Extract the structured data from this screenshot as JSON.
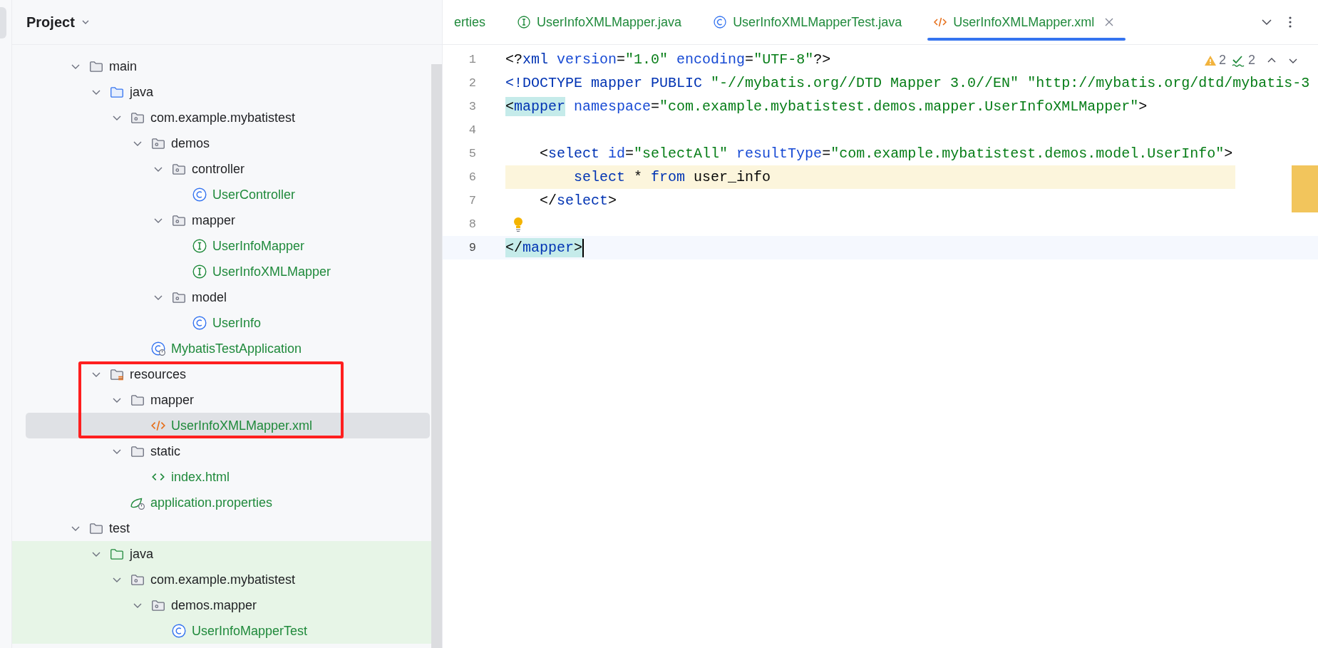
{
  "project_panel": {
    "title": "Project",
    "tree": [
      {
        "label": "main",
        "kind": "folder",
        "expanded": true,
        "selected": false,
        "vcs_added": false,
        "boxed": false,
        "children": [
          {
            "label": "java",
            "kind": "source-folder",
            "expanded": true,
            "selected": false,
            "vcs_added": false,
            "boxed": false,
            "children": [
              {
                "label": "com.example.mybatistest",
                "kind": "package",
                "expanded": true,
                "selected": false,
                "vcs_added": false,
                "boxed": false,
                "children": [
                  {
                    "label": "demos",
                    "kind": "package",
                    "expanded": true,
                    "selected": false,
                    "vcs_added": false,
                    "boxed": false,
                    "children": [
                      {
                        "label": "controller",
                        "kind": "package",
                        "expanded": true,
                        "selected": false,
                        "vcs_added": false,
                        "boxed": false,
                        "children": [
                          {
                            "label": "UserController",
                            "kind": "class",
                            "selected": false,
                            "vcs_added": true,
                            "boxed": false
                          }
                        ]
                      },
                      {
                        "label": "mapper",
                        "kind": "package",
                        "expanded": true,
                        "selected": false,
                        "vcs_added": false,
                        "boxed": false,
                        "children": [
                          {
                            "label": "UserInfoMapper",
                            "kind": "interface",
                            "selected": false,
                            "vcs_added": true,
                            "boxed": false
                          },
                          {
                            "label": "UserInfoXMLMapper",
                            "kind": "interface",
                            "selected": false,
                            "vcs_added": true,
                            "boxed": false
                          }
                        ]
                      },
                      {
                        "label": "model",
                        "kind": "package",
                        "expanded": true,
                        "selected": false,
                        "vcs_added": false,
                        "boxed": false,
                        "children": [
                          {
                            "label": "UserInfo",
                            "kind": "class",
                            "selected": false,
                            "vcs_added": true,
                            "boxed": false
                          }
                        ]
                      }
                    ]
                  },
                  {
                    "label": "MybatisTestApplication",
                    "kind": "spring-class",
                    "selected": false,
                    "vcs_added": true,
                    "boxed": false
                  }
                ]
              }
            ]
          },
          {
            "label": "resources",
            "kind": "resources-folder",
            "expanded": true,
            "selected": false,
            "vcs_added": false,
            "boxed": true,
            "children": [
              {
                "label": "mapper",
                "kind": "folder",
                "expanded": true,
                "selected": false,
                "vcs_added": false,
                "boxed": true,
                "children": [
                  {
                    "label": "UserInfoXMLMapper.xml",
                    "kind": "xml",
                    "selected": true,
                    "vcs_added": true,
                    "boxed": true
                  }
                ]
              },
              {
                "label": "static",
                "kind": "folder",
                "expanded": true,
                "selected": false,
                "vcs_added": false,
                "boxed": false,
                "children": [
                  {
                    "label": "index.html",
                    "kind": "html",
                    "selected": false,
                    "vcs_added": true,
                    "boxed": false
                  }
                ]
              },
              {
                "label": "application.properties",
                "kind": "spring-props",
                "selected": false,
                "vcs_added": true,
                "boxed": false
              }
            ]
          }
        ]
      },
      {
        "label": "test",
        "kind": "folder",
        "expanded": true,
        "selected": false,
        "vcs_added": false,
        "boxed": false,
        "children": [
          {
            "label": "java",
            "kind": "test-folder",
            "expanded": true,
            "selected": false,
            "vcs_added": false,
            "boxed": false,
            "children": [
              {
                "label": "com.example.mybatistest",
                "kind": "package",
                "expanded": true,
                "selected": false,
                "vcs_added": false,
                "boxed": false,
                "children": [
                  {
                    "label": "demos.mapper",
                    "kind": "package",
                    "expanded": true,
                    "selected": false,
                    "vcs_added": false,
                    "boxed": false,
                    "children": [
                      {
                        "label": "UserInfoMapperTest",
                        "kind": "class",
                        "selected": false,
                        "vcs_added": true,
                        "boxed": false
                      }
                    ]
                  }
                ]
              }
            ]
          }
        ]
      }
    ]
  },
  "editor": {
    "tabs": [
      {
        "label": "erties",
        "kind": "plain",
        "selected": false,
        "vcs_added": true
      },
      {
        "label": "UserInfoXMLMapper.java",
        "kind": "interface",
        "selected": false,
        "vcs_added": true
      },
      {
        "label": "UserInfoXMLMapperTest.java",
        "kind": "class",
        "selected": false,
        "vcs_added": true
      },
      {
        "label": "UserInfoXMLMapper.xml",
        "kind": "xml",
        "selected": true,
        "vcs_added": true
      }
    ],
    "inspections": [
      {
        "kind": "warning",
        "count": "2"
      },
      {
        "kind": "typo",
        "count": "2"
      }
    ],
    "lines": [
      {
        "number": "1",
        "kind": "normal",
        "segments": [
          {
            "text": "<?",
            "kind": "punct"
          },
          {
            "text": "xml",
            "kind": "tag"
          },
          {
            "text": " version",
            "kind": "attr"
          },
          {
            "text": "=",
            "kind": "punct"
          },
          {
            "text": "\"1.0\"",
            "kind": "string"
          },
          {
            "text": " encoding",
            "kind": "attr"
          },
          {
            "text": "=",
            "kind": "punct"
          },
          {
            "text": "\"UTF-8\"",
            "kind": "string"
          },
          {
            "text": "?>",
            "kind": "punct"
          }
        ]
      },
      {
        "number": "2",
        "kind": "normal",
        "segments": [
          {
            "text": "<!DOCTYPE mapper PUBLIC ",
            "kind": "tag"
          },
          {
            "text": "\"-//mybatis.org//DTD Mapper 3.0//EN\"",
            "kind": "string"
          },
          {
            "text": " \"http://mybatis.org/dtd/mybatis-3",
            "kind": "string"
          }
        ]
      },
      {
        "number": "3",
        "kind": "normal",
        "segments": [
          {
            "text": "<",
            "kind": "punct",
            "matched": true
          },
          {
            "text": "mapper",
            "kind": "tag",
            "matched": true
          },
          {
            "text": " namespace",
            "kind": "attr"
          },
          {
            "text": "=",
            "kind": "punct"
          },
          {
            "text": "\"com.example.mybatistest.demos.mapper.UserInfoXMLMapper\"",
            "kind": "string"
          },
          {
            "text": ">",
            "kind": "punct"
          }
        ]
      },
      {
        "number": "4",
        "kind": "normal"
      },
      {
        "number": "5",
        "kind": "normal",
        "segments": [
          {
            "text": "    <",
            "kind": "punct"
          },
          {
            "text": "select",
            "kind": "tag"
          },
          {
            "text": " id",
            "kind": "attr"
          },
          {
            "text": "=",
            "kind": "punct"
          },
          {
            "text": "\"selectAll\"",
            "kind": "string"
          },
          {
            "text": " resultType",
            "kind": "attr"
          },
          {
            "text": "=",
            "kind": "punct"
          },
          {
            "text": "\"com.example.mybatistest.demos.model.UserInfo\"",
            "kind": "string"
          },
          {
            "text": ">",
            "kind": "punct"
          }
        ]
      },
      {
        "number": "6",
        "kind": "injected",
        "segments": [
          {
            "text": "        select",
            "kind": "keyword"
          },
          {
            "text": " * ",
            "kind": "plain"
          },
          {
            "text": "from",
            "kind": "keyword"
          },
          {
            "text": " user_info",
            "kind": "plain"
          }
        ]
      },
      {
        "number": "7",
        "kind": "normal",
        "segments": [
          {
            "text": "    </",
            "kind": "punct"
          },
          {
            "text": "select",
            "kind": "tag"
          },
          {
            "text": ">",
            "kind": "punct"
          }
        ]
      },
      {
        "number": "8",
        "kind": "normal",
        "bulb": true
      },
      {
        "number": "9",
        "kind": "current",
        "caret": true,
        "segments": [
          {
            "text": "</",
            "kind": "punct",
            "matched": true
          },
          {
            "text": "mapper",
            "kind": "tag",
            "matched": true
          },
          {
            "text": ">",
            "kind": "punct",
            "matched": true
          }
        ]
      }
    ]
  }
}
